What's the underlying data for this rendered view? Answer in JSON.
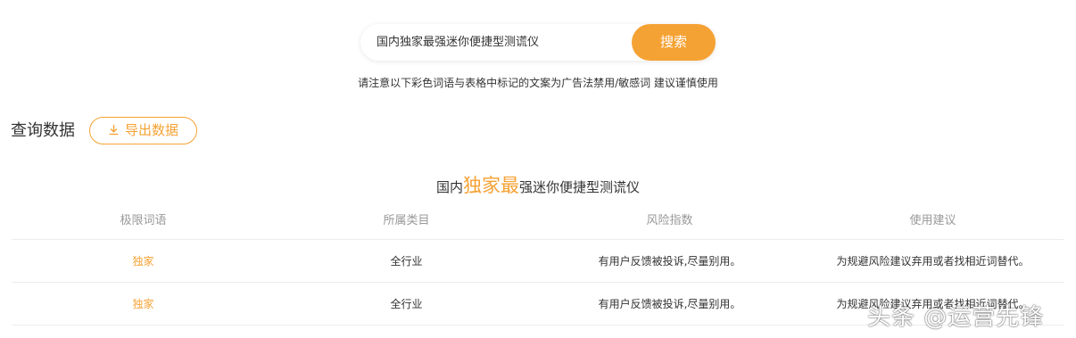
{
  "search": {
    "value": "国内独家最强迷你便捷型测谎仪",
    "button_label": "搜索"
  },
  "notice": "请注意以下彩色词语与表格中标记的文案为广告法禁用/敏感词 建议谨慎使用",
  "results": {
    "section_title": "查询数据",
    "export_label": "导出数据"
  },
  "phrase": {
    "before": "国内",
    "highlight": "独家最",
    "after": "强迷你便捷型测谎仪"
  },
  "table": {
    "headers": [
      "极限词语",
      "所属类目",
      "风险指数",
      "使用建议"
    ],
    "rows": [
      [
        "独家",
        "全行业",
        "有用户反馈被投诉,尽量别用。",
        "为规避风险建议弃用或者找相近词替代。"
      ],
      [
        "独家",
        "全行业",
        "有用户反馈被投诉,尽量别用。",
        "为规避风险建议弃用或者找相近词替代。"
      ]
    ]
  },
  "watermark": "头条 @运营先锋",
  "colors": {
    "accent": "#f5a234",
    "text": "#333333",
    "muted": "#999999"
  }
}
